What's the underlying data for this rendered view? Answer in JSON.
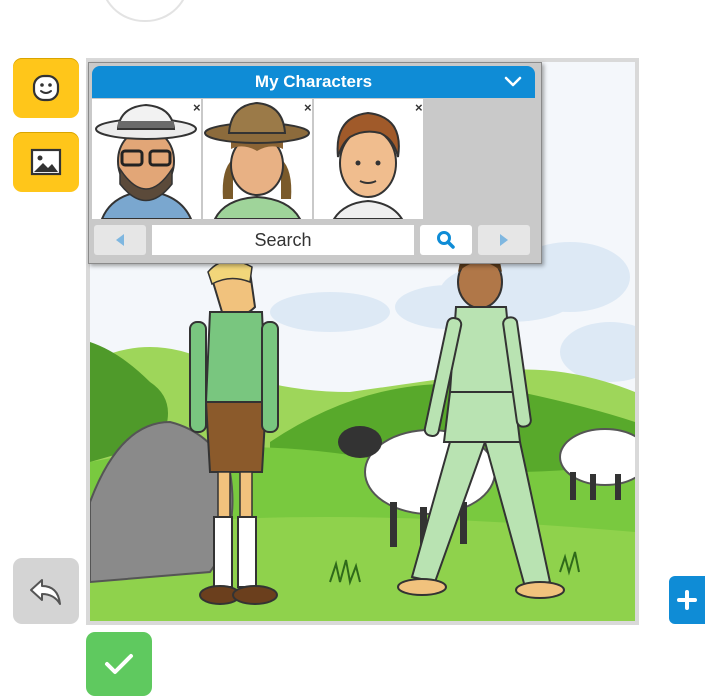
{
  "library": {
    "title": "My Characters",
    "search_label": "Search",
    "remove_glyph": "×",
    "characters": [
      {
        "name": "bearded-man-glasses-hat"
      },
      {
        "name": "cowboy-hat-woman"
      },
      {
        "name": "brown-haired-boy"
      }
    ]
  },
  "toolbar": {
    "characters_icon": "smiley-icon",
    "scenes_icon": "image-icon",
    "undo_icon": "undo-arrow-icon",
    "confirm_icon": "checkmark-icon",
    "add_icon": "plus-icon"
  },
  "colors": {
    "tool_yellow": "#ffc61a",
    "header_blue": "#0f8cd6",
    "confirm_green": "#5fc95f",
    "undo_gray": "#d4d4d4"
  }
}
